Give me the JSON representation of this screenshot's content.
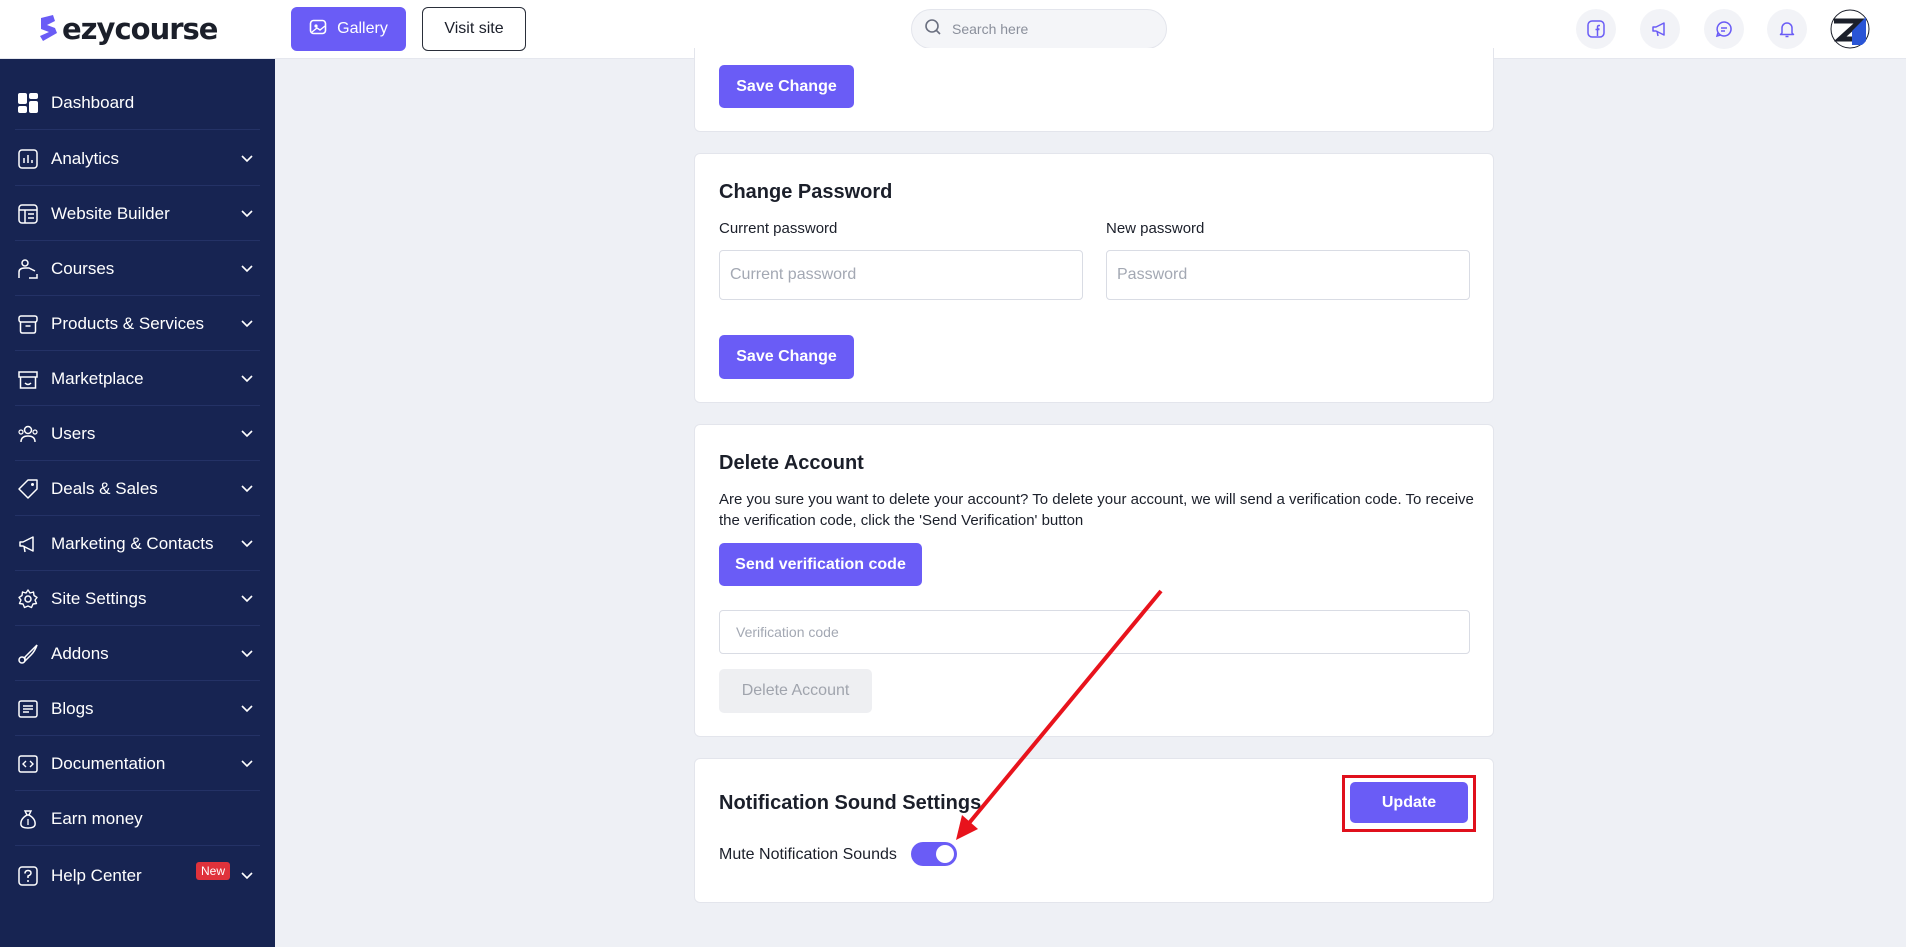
{
  "brand": {
    "name": "ezycourse",
    "accent": "#6a5cf6",
    "sidebar_bg": "#172452"
  },
  "header": {
    "gallery_label": "Gallery",
    "visit_label": "Visit site",
    "search_placeholder": "Search here",
    "icons": [
      "facebook-icon",
      "megaphone-icon",
      "chat-icon",
      "bell-icon"
    ]
  },
  "sidebar": {
    "items": [
      {
        "label": "Dashboard",
        "icon": "dashboard-icon"
      },
      {
        "label": "Analytics",
        "icon": "analytics-icon"
      },
      {
        "label": "Website Builder",
        "icon": "website-builder-icon"
      },
      {
        "label": "Courses",
        "icon": "courses-icon"
      },
      {
        "label": "Products & Services",
        "icon": "box-icon"
      },
      {
        "label": "Marketplace",
        "icon": "store-icon"
      },
      {
        "label": "Users",
        "icon": "users-icon"
      },
      {
        "label": "Deals & Sales",
        "icon": "tag-icon"
      },
      {
        "label": "Marketing & Contacts",
        "icon": "megaphone-icon"
      },
      {
        "label": "Site Settings",
        "icon": "gear-icon"
      },
      {
        "label": "Addons",
        "icon": "addons-icon"
      },
      {
        "label": "Blogs",
        "icon": "blog-icon"
      },
      {
        "label": "Documentation",
        "icon": "documentation-icon"
      },
      {
        "label": "Earn money",
        "icon": "money-bag-icon"
      },
      {
        "label": "Help Center",
        "icon": "help-icon",
        "badge": "New"
      }
    ]
  },
  "profile_card": {
    "save_label": "Save Change"
  },
  "password_card": {
    "title": "Change Password",
    "current_label": "Current password",
    "current_placeholder": "Current password",
    "new_label": "New password",
    "new_placeholder": "Password",
    "save_label": "Save Change"
  },
  "delete_card": {
    "title": "Delete Account",
    "description": "Are you sure you want to delete your account? To delete your account, we will send a verification code. To receive the verification code, click the 'Send Verification' button",
    "send_label": "Send verification code",
    "code_placeholder": "Verification code",
    "delete_label": "Delete Account"
  },
  "notification_card": {
    "title": "Notification Sound Settings",
    "update_label": "Update",
    "mute_label": "Mute Notification Sounds",
    "mute_enabled": true
  }
}
